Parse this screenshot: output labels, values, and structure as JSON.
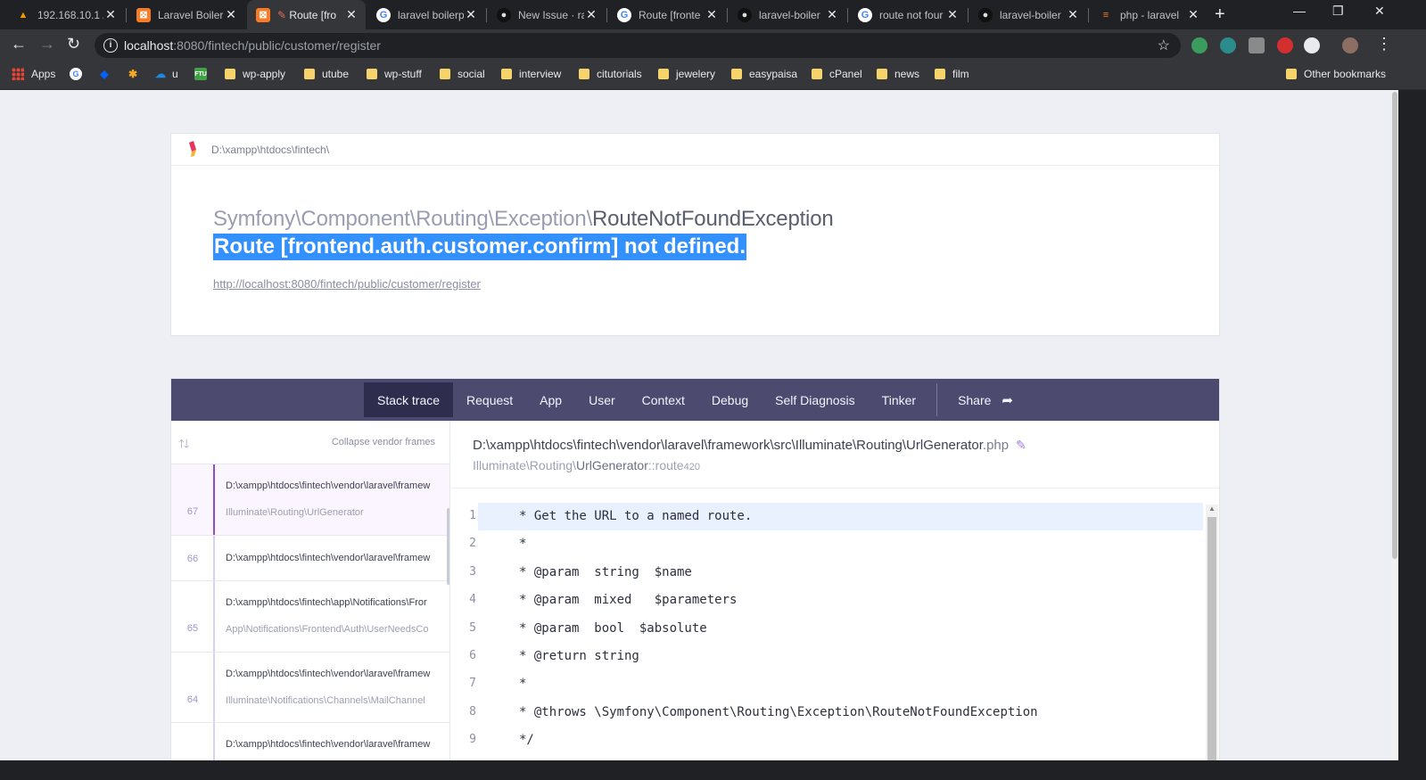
{
  "browser": {
    "tabs": [
      {
        "title": "192.168.10.1 / ",
        "icon": "router-icon"
      },
      {
        "title": "Laravel Boiler",
        "icon": "xampp-icon"
      },
      {
        "title": "Route [fro",
        "icon": "xampp-icon",
        "active": true
      },
      {
        "title": "laravel boilerp",
        "icon": "google-icon"
      },
      {
        "title": "New Issue · ra",
        "icon": "github-icon"
      },
      {
        "title": "Route [fronte",
        "icon": "google-icon"
      },
      {
        "title": "laravel-boiler",
        "icon": "github-icon"
      },
      {
        "title": "route not four",
        "icon": "google-icon"
      },
      {
        "title": "laravel-boiler",
        "icon": "github-icon"
      },
      {
        "title": "php - laravel",
        "icon": "stackoverflow-icon"
      }
    ],
    "url_host": "localhost",
    "url_rest": ":8080/fintech/public/customer/register",
    "bookmarks": [
      "Apps",
      "u",
      "wp-apply",
      "utube",
      "wp-stuff",
      "social",
      "interview",
      "citutorials",
      "jewelery",
      "easypaisa",
      "cPanel",
      "news",
      "film",
      "Other bookmarks"
    ]
  },
  "error": {
    "path": "D:\\xampp\\htdocs\\fintech\\",
    "namespace": "Symfony\\Component\\Routing\\Exception\\",
    "exception_class": "RouteNotFoundException",
    "message": "Route [frontend.auth.customer.confirm] not defined.",
    "url": "http://localhost:8080/fintech/public/customer/register"
  },
  "tabs": [
    "Stack trace",
    "Request",
    "App",
    "User",
    "Context",
    "Debug",
    "Self Diagnosis",
    "Tinker"
  ],
  "share_label": "Share",
  "frames_header": {
    "collapse": "Collapse vendor frames"
  },
  "frames": [
    {
      "num": "67",
      "file": "D:\\xampp\\htdocs\\fintech\\vendor\\laravel\\framew",
      "cls": "Illuminate\\Routing\\UrlGenerator"
    },
    {
      "num": "66",
      "file": "D:\\xampp\\htdocs\\fintech\\vendor\\laravel\\framew",
      "cls": ""
    },
    {
      "num": "65",
      "file": "D:\\xampp\\htdocs\\fintech\\app\\Notifications\\Fror",
      "cls": "App\\Notifications\\Frontend\\Auth\\UserNeedsCo"
    },
    {
      "num": "64",
      "file": "D:\\xampp\\htdocs\\fintech\\vendor\\laravel\\framew",
      "cls": "Illuminate\\Notifications\\Channels\\MailChannel"
    },
    {
      "num": "",
      "file": "D:\\xampp\\htdocs\\fintech\\vendor\\laravel\\framew",
      "cls": ""
    }
  ],
  "code": {
    "file_base": "D:\\xampp\\htdocs\\fintech\\vendor\\laravel\\framework\\src\\Illuminate\\Routing\\UrlGenerator",
    "file_ext": ".php",
    "ns": "Illuminate\\Routing\\",
    "cls": "UrlGenerator",
    "method": "::route",
    "line": "420",
    "lines": [
      {
        "n": "1",
        "t": "* Get the URL to a named route."
      },
      {
        "n": "2",
        "t": "*"
      },
      {
        "n": "3",
        "t": "* @param  string  $name"
      },
      {
        "n": "4",
        "t": "* @param  mixed   $parameters"
      },
      {
        "n": "5",
        "t": "* @param  bool  $absolute"
      },
      {
        "n": "6",
        "t": "* @return string"
      },
      {
        "n": "7",
        "t": "*"
      },
      {
        "n": "8",
        "t": "* @throws \\Symfony\\Component\\Routing\\Exception\\RouteNotFoundException"
      },
      {
        "n": "9",
        "t": "*/"
      }
    ]
  }
}
